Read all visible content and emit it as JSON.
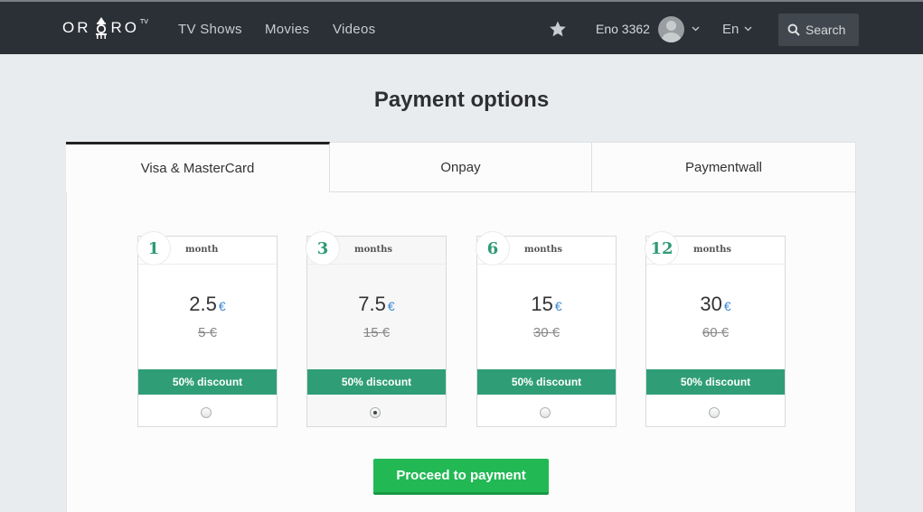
{
  "header": {
    "logo_text_left": "OR",
    "logo_text_right": "RO",
    "logo_sup": "TV",
    "nav": {
      "tv_shows": "TV Shows",
      "movies": "Movies",
      "videos": "Videos"
    },
    "favorites_icon": "star-icon",
    "user_name": "Eno 3362",
    "language": "En",
    "search_label": "Search",
    "colors": {
      "bar": "#2b3036",
      "search_bg": "#41474e"
    }
  },
  "page": {
    "title": "Payment options",
    "tabs": [
      {
        "label": "Visa & MasterCard",
        "active": true
      },
      {
        "label": "Onpay",
        "active": false
      },
      {
        "label": "Paymentwall",
        "active": false
      }
    ],
    "plans": [
      {
        "count": "1",
        "unit": "month",
        "price": "2.5",
        "old_price": "5",
        "currency": "€",
        "discount": "50% discount",
        "selected": false
      },
      {
        "count": "3",
        "unit": "months",
        "price": "7.5",
        "old_price": "15",
        "currency": "€",
        "discount": "50% discount",
        "selected": true
      },
      {
        "count": "6",
        "unit": "months",
        "price": "15",
        "old_price": "30",
        "currency": "€",
        "discount": "50% discount",
        "selected": false
      },
      {
        "count": "12",
        "unit": "months",
        "price": "30",
        "old_price": "60",
        "currency": "€",
        "discount": "50% discount",
        "selected": false
      }
    ],
    "proceed_label": "Proceed to payment",
    "colors": {
      "accent_green": "#2f9e77",
      "button_green": "#22b955",
      "currency_blue": "#3a86d4"
    }
  }
}
